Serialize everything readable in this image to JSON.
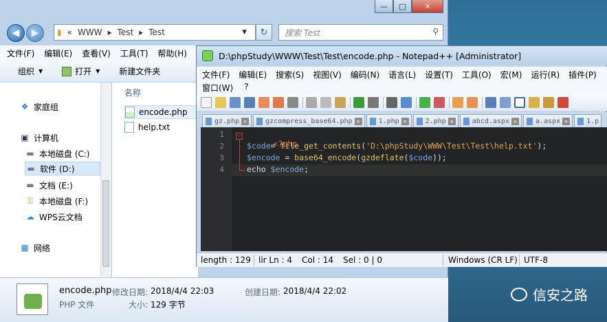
{
  "explorer": {
    "address": {
      "prefix": "«",
      "segments": [
        "WWW",
        "Test",
        "Test"
      ]
    },
    "search_placeholder": "搜索 Test",
    "menu": [
      "文件(F)",
      "编辑(E)",
      "查看(V)",
      "工具(T)",
      "帮助(H)"
    ],
    "commands": {
      "organize": "组织",
      "open": "打开",
      "new_folder": "新建文件夹"
    },
    "nav": {
      "homegroup": "家庭组",
      "computer": "计算机",
      "drives": [
        "本地磁盘 (C:)",
        "软件 (D:)",
        "文档 (E:)",
        "本地磁盘 (F:)",
        "WPS云文档"
      ],
      "network": "网络"
    },
    "files": {
      "column_name": "名称",
      "items": [
        "encode.php",
        "help.txt"
      ]
    },
    "details": {
      "filename": "encode.php",
      "filetype": "PHP 文件",
      "modified_label": "修改日期:",
      "modified": "2018/4/4 22:03",
      "created_label": "创建日期:",
      "created": "2018/4/4 22:02",
      "size_label": "大小:",
      "size": "129 字节"
    }
  },
  "notepad": {
    "title": "D:\\phpStudy\\WWW\\Test\\Test\\encode.php - Notepad++ [Administrator]",
    "menu_row1": [
      "文件(F)",
      "编辑(E)",
      "搜索(S)",
      "视图(V)",
      "编码(N)",
      "语言(L)",
      "设置(T)",
      "工具(O)",
      "宏(M)",
      "运行(R)",
      "插件(P)"
    ],
    "menu_row2": [
      "窗口(W)",
      "?"
    ],
    "tabs": [
      "gz.php",
      "gzcompress_base64.php",
      "1.php",
      "2.php",
      "abcd.aspx",
      "a.aspx",
      "1.p"
    ],
    "line_numbers": [
      "1",
      "2",
      "3",
      "4"
    ],
    "code": {
      "l1": "<?php",
      "l2_var": "$code",
      "l2_eq": "= ",
      "l2_fn": "file_get_contents",
      "l2_open": "(",
      "l2_str": "'D:\\phpStudy\\WWW\\Test\\Test\\help.txt'",
      "l2_close": ");",
      "l3_var": "$encode",
      "l3_eq": " = ",
      "l3_fn1": "base64_encode",
      "l3_p1": "(",
      "l3_fn2": "gzdeflate",
      "l3_p2": "(",
      "l3_arg": "$code",
      "l3_close": "));",
      "l4_kw": "echo ",
      "l4_var": "$encode",
      "l4_end": ";"
    },
    "status": {
      "length": "length : 129",
      "position": "lir Ln : 4",
      "col": "Col : 14",
      "sel": "Sel : 0 | 0",
      "eol": "Windows (CR LF)",
      "encoding": "UTF-8"
    }
  },
  "watermark": "信安之路"
}
